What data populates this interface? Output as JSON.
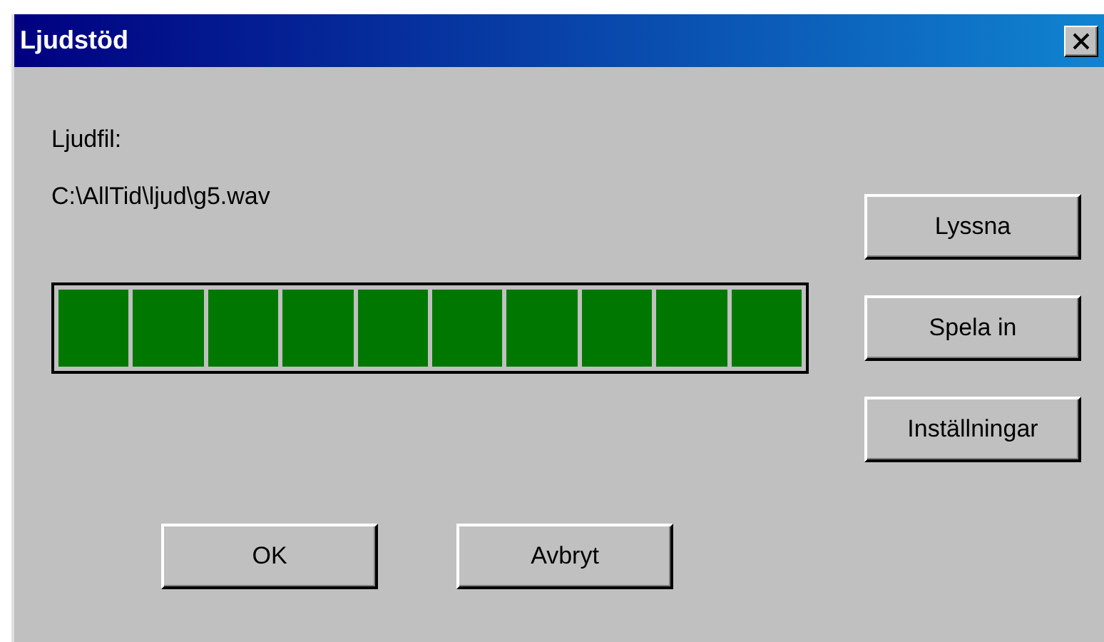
{
  "window": {
    "title": "Ljudstöd"
  },
  "file_label": "Ljudfil:",
  "file_path": "C:\\AllTid\\ljud\\g5.wav",
  "meter": {
    "level": 1
  },
  "side_buttons": [
    "Lyssna",
    "Spela in",
    "Inställningar"
  ],
  "buttons": [
    "OK",
    "Avbryt"
  ]
}
